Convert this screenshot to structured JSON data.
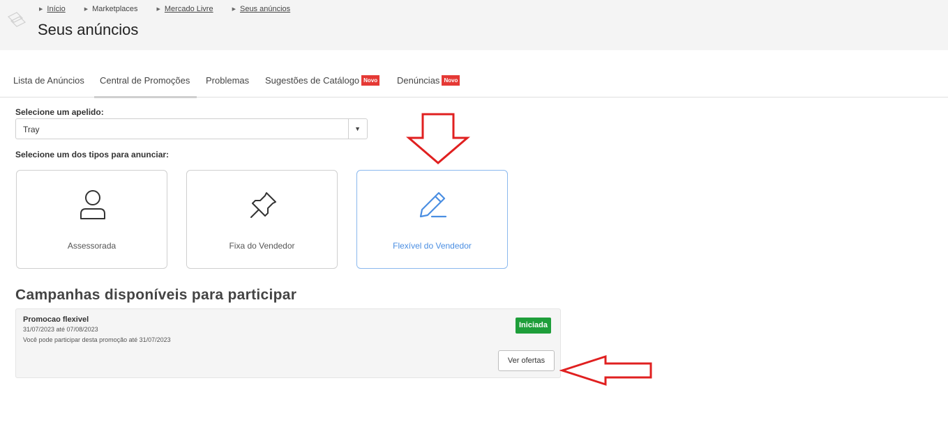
{
  "breadcrumb": [
    {
      "label": "Início",
      "link": true
    },
    {
      "label": "Marketplaces",
      "link": false
    },
    {
      "label": "Mercado Livre",
      "link": true
    },
    {
      "label": "Seus anúncios",
      "link": true
    }
  ],
  "page_title": "Seus anúncios",
  "tabs": [
    {
      "label": "Lista de Anúncios"
    },
    {
      "label": "Central de Promoções",
      "active": true
    },
    {
      "label": "Problemas"
    },
    {
      "label": "Sugestões de Catálogo",
      "badge": "Novo"
    },
    {
      "label": "Denúncias",
      "badge": "Novo"
    }
  ],
  "nickname": {
    "label": "Selecione um apelido:",
    "selected": "Tray"
  },
  "types": {
    "label": "Selecione um dos tipos para anunciar:",
    "options": [
      {
        "label": "Assessorada",
        "icon": "user-icon"
      },
      {
        "label": "Fixa do Vendedor",
        "icon": "pin-icon"
      },
      {
        "label": "Flexível do Vendedor",
        "icon": "pencil-icon",
        "selected": true
      }
    ]
  },
  "campaigns": {
    "title": "Campanhas disponíveis para participar",
    "items": [
      {
        "name": "Promocao flexivel",
        "dates": "31/07/2023 até 07/08/2023",
        "note": "Você pode participar desta promoção até 31/07/2023",
        "status": "Iniciada",
        "action": "Ver ofertas"
      }
    ]
  },
  "colors": {
    "accent_blue": "#4a8ee2",
    "status_green": "#1e9e3a",
    "badge_red": "#e53935",
    "annotation_red": "#e02020"
  }
}
